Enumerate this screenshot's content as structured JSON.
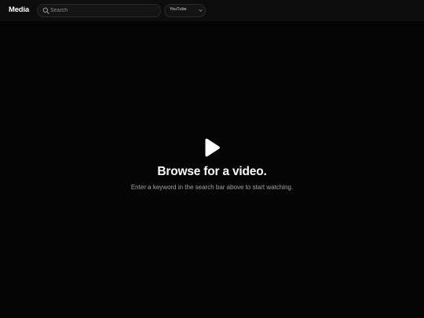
{
  "header": {
    "brand": "Media",
    "search": {
      "placeholder": "Search",
      "value": ""
    },
    "source_select": {
      "selected": "YouTube"
    }
  },
  "empty_state": {
    "title": "Browse for a video.",
    "subtitle": "Enter a keyword in the search bar above to start watching."
  },
  "icons": {
    "search": "search-icon",
    "chevron": "chevron-down-icon",
    "play": "play-icon"
  },
  "colors": {
    "background": "#050505",
    "topbar": "#0d0d0d",
    "text_primary": "#ffffff",
    "text_secondary": "#a3a3a3"
  }
}
